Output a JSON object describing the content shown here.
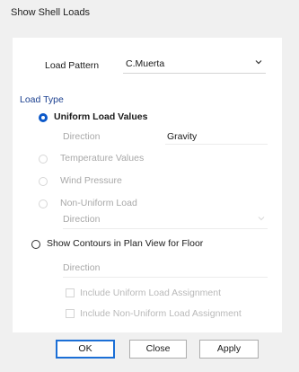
{
  "window": {
    "title": "Show Shell Loads"
  },
  "load_pattern": {
    "label": "Load Pattern",
    "value": "C.Muerta"
  },
  "load_type": {
    "group_label": "Load Type",
    "uniform_load_values": {
      "label": "Uniform Load Values",
      "selected": true
    },
    "direction": {
      "label": "Direction",
      "value": "Gravity"
    },
    "temperature_values": {
      "label": "Temperature Values",
      "enabled": false
    },
    "wind_pressure": {
      "label": "Wind Pressure",
      "enabled": false
    },
    "non_uniform_load": {
      "label": "Non-Uniform Load",
      "enabled": false
    },
    "non_uniform_direction": {
      "label": "Direction"
    },
    "show_contours": {
      "label": "Show Contours in Plan View for Floor",
      "selected": false
    },
    "contours_direction": {
      "label": "Direction"
    },
    "include_uniform": {
      "label": "Include Uniform Load Assignment",
      "checked": false
    },
    "include_non_uniform": {
      "label": "Include Non-Uniform Load Assignment",
      "checked": false
    }
  },
  "buttons": {
    "ok": "OK",
    "close": "Close",
    "apply": "Apply"
  },
  "colors": {
    "accent": "#0b58c9",
    "group_label": "#1a3f8f",
    "disabled_text": "#a8a8a8"
  },
  "icons": {
    "dropdown": "chevron-down-icon"
  }
}
